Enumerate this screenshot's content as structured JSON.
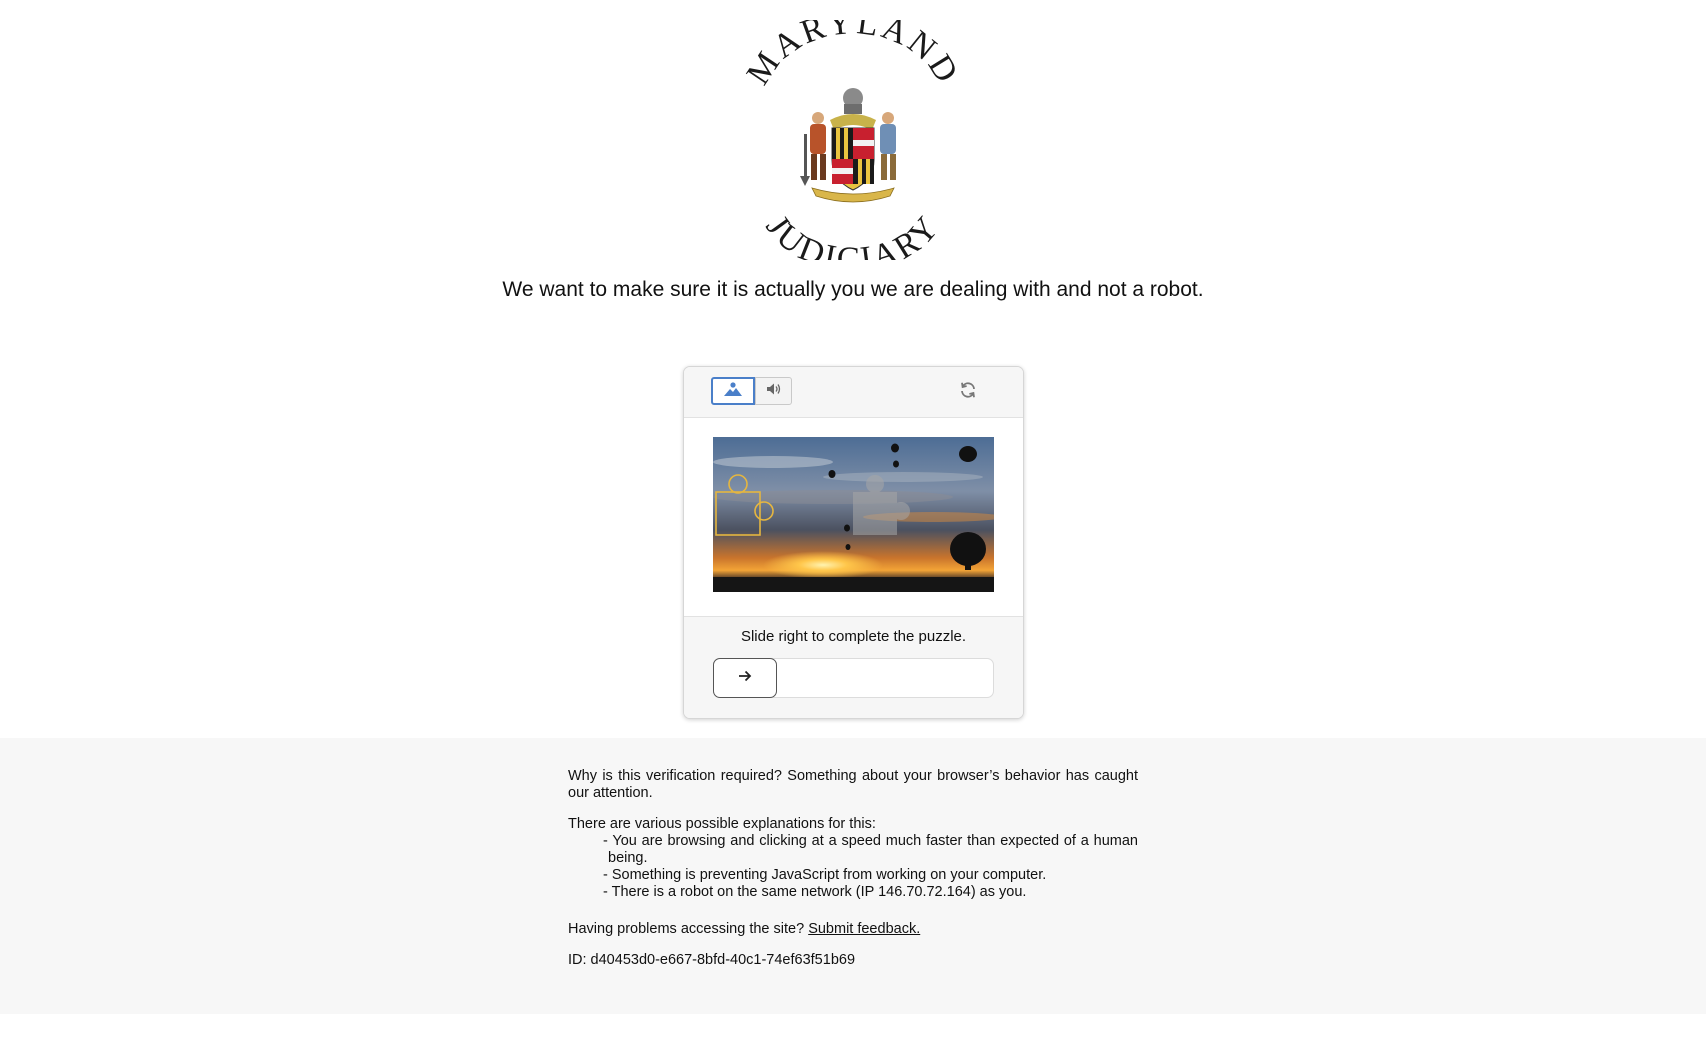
{
  "logo": {
    "top_text": "MARYLAND",
    "bottom_text": "JUDICIARY"
  },
  "headline": "We want to make sure it is actually you we are dealing with and not a robot.",
  "captcha": {
    "modes": [
      {
        "name": "image",
        "icon": "image-icon",
        "selected": true
      },
      {
        "name": "audio",
        "icon": "speaker-icon",
        "selected": false
      }
    ],
    "refresh_icon": "refresh-icon",
    "instruction": "Slide right to complete the puzzle.",
    "slider_icon": "arrow-right-icon",
    "slider_progress": 0,
    "accent_color": "#4a7fc9"
  },
  "info": {
    "why": "Why is this verification required? Something about your browser’s behavior has caught our attention.",
    "explanations_title": "There are various possible explanations for this:",
    "reasons": [
      "- You are browsing and clicking at a speed much faster than expected of a human being.",
      "- Something is preventing JavaScript from working on your computer.",
      "- There is a robot on the same network (IP 146.70.72.164) as you."
    ],
    "problems_prefix": "Having problems accessing the site?",
    "feedback_link": "Submit feedback.",
    "request_id": "ID: d40453d0-e667-8bfd-40c1-74ef63f51b69"
  }
}
